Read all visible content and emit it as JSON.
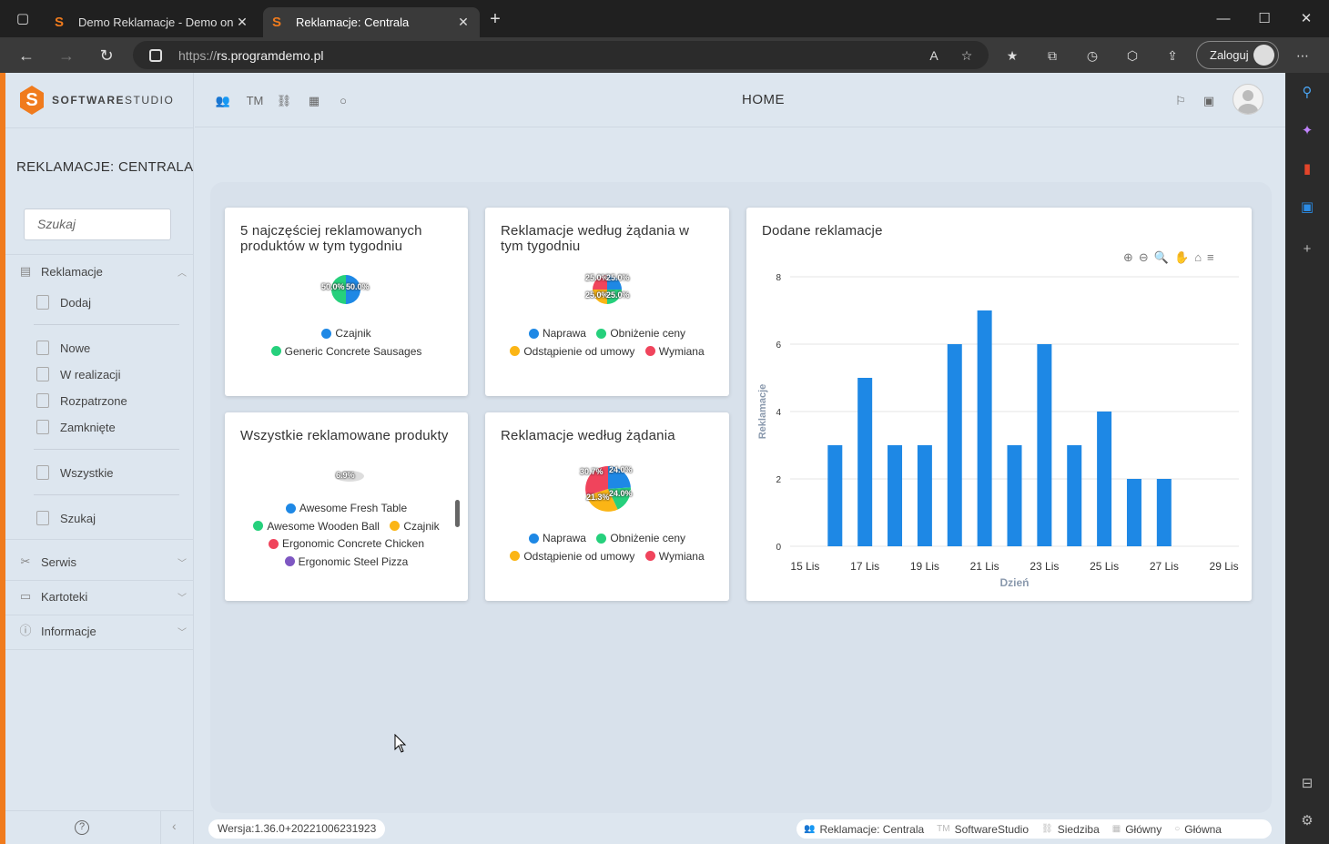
{
  "browser": {
    "tabs": [
      {
        "label": "Demo Reklamacje - Demo on lin",
        "active": false
      },
      {
        "label": "Reklamacje: Centrala",
        "active": true
      }
    ],
    "url_protocol": "https://",
    "url_host": "rs.programdemo.pl",
    "login_label": "Zaloguj"
  },
  "app": {
    "brand_bold": "SOFTWARE",
    "brand_light": "STUDIO",
    "page_title": "HOME",
    "section_title": "REKLAMACJE: CENTRALA",
    "search_placeholder": "Szukaj",
    "sidebar": {
      "reklamacje": "Reklamacje",
      "dodaj": "Dodaj",
      "nowe": "Nowe",
      "w_realizacji": "W realizacji",
      "rozpatrzone": "Rozpatrzone",
      "zamkniete": "Zamknięte",
      "wszystkie": "Wszystkie",
      "szukaj": "Szukaj",
      "serwis": "Serwis",
      "kartoteki": "Kartoteki",
      "informacje": "Informacje"
    },
    "top_icons": [
      "users-icon",
      "tm-icon",
      "org-tree-icon",
      "building-icon",
      "circle-icon"
    ],
    "tm_label": "TM"
  },
  "cards": {
    "top5": {
      "title": "5 najczęściej reklamowanych produktów w tym tygodniu",
      "pie_labels": [
        "50.0%",
        "50.0%"
      ],
      "legend": [
        {
          "label": "Czajnik",
          "color": "#1e88e5"
        },
        {
          "label": "Generic Concrete Sausages",
          "color": "#26d07c"
        }
      ]
    },
    "week_requests": {
      "title": "Reklamacje według żądania w tym tygodniu",
      "pie_labels": [
        "25.0%",
        "25.0%",
        "25.0%",
        "25.0%"
      ],
      "legend": [
        {
          "label": "Naprawa",
          "color": "#1e88e5"
        },
        {
          "label": "Obniżenie ceny",
          "color": "#26d07c"
        },
        {
          "label": "Odstąpienie od umowy",
          "color": "#fbb515"
        },
        {
          "label": "Wymiana",
          "color": "#f0445c"
        }
      ]
    },
    "all_products": {
      "title": "Wszystkie reklamowane produkty",
      "pie_labels": [
        "6.9%"
      ],
      "legend": [
        {
          "label": "Awesome Fresh Table",
          "color": "#1e88e5"
        },
        {
          "label": "Awesome Wooden Ball",
          "color": "#26d07c"
        },
        {
          "label": "Czajnik",
          "color": "#fbb515"
        },
        {
          "label": "Ergonomic Concrete Chicken",
          "color": "#f0445c"
        },
        {
          "label": "Ergonomic Steel Pizza",
          "color": "#7e57c2"
        }
      ]
    },
    "requests": {
      "title": "Reklamacje według żądania",
      "pie_labels": [
        "30.7%",
        "24.0%",
        "21.3%",
        "24.0%"
      ],
      "legend": [
        {
          "label": "Naprawa",
          "color": "#1e88e5"
        },
        {
          "label": "Obniżenie ceny",
          "color": "#26d07c"
        },
        {
          "label": "Odstąpienie od umowy",
          "color": "#fbb515"
        },
        {
          "label": "Wymiana",
          "color": "#f0445c"
        }
      ]
    },
    "added": {
      "title": "Dodane reklamacje"
    }
  },
  "chart_data": {
    "type": "bar",
    "title": "Dodane reklamacje",
    "xlabel": "Dzień",
    "ylabel": "Reklamacje",
    "ylim": [
      0,
      8
    ],
    "yticks": [
      0,
      2,
      4,
      6,
      8
    ],
    "xticks": [
      "15 Lis",
      "17 Lis",
      "19 Lis",
      "21 Lis",
      "23 Lis",
      "25 Lis",
      "27 Lis",
      "29 Lis"
    ],
    "categories": [
      "16 Lis",
      "17 Lis",
      "18 Lis",
      "19 Lis",
      "20 Lis",
      "21 Lis",
      "22 Lis",
      "23 Lis",
      "24 Lis",
      "25 Lis",
      "26 Lis",
      "27 Lis"
    ],
    "values": [
      3,
      5,
      3,
      3,
      6,
      7,
      3,
      6,
      3,
      4,
      2,
      2
    ],
    "color": "#1e88e5",
    "grid": true
  },
  "footer": {
    "version": "Wersja:1.36.0+20221006231923",
    "status": [
      "Reklamacje: Centrala",
      "SoftwareStudio",
      "Siedziba",
      "Główny",
      "Główna"
    ]
  }
}
